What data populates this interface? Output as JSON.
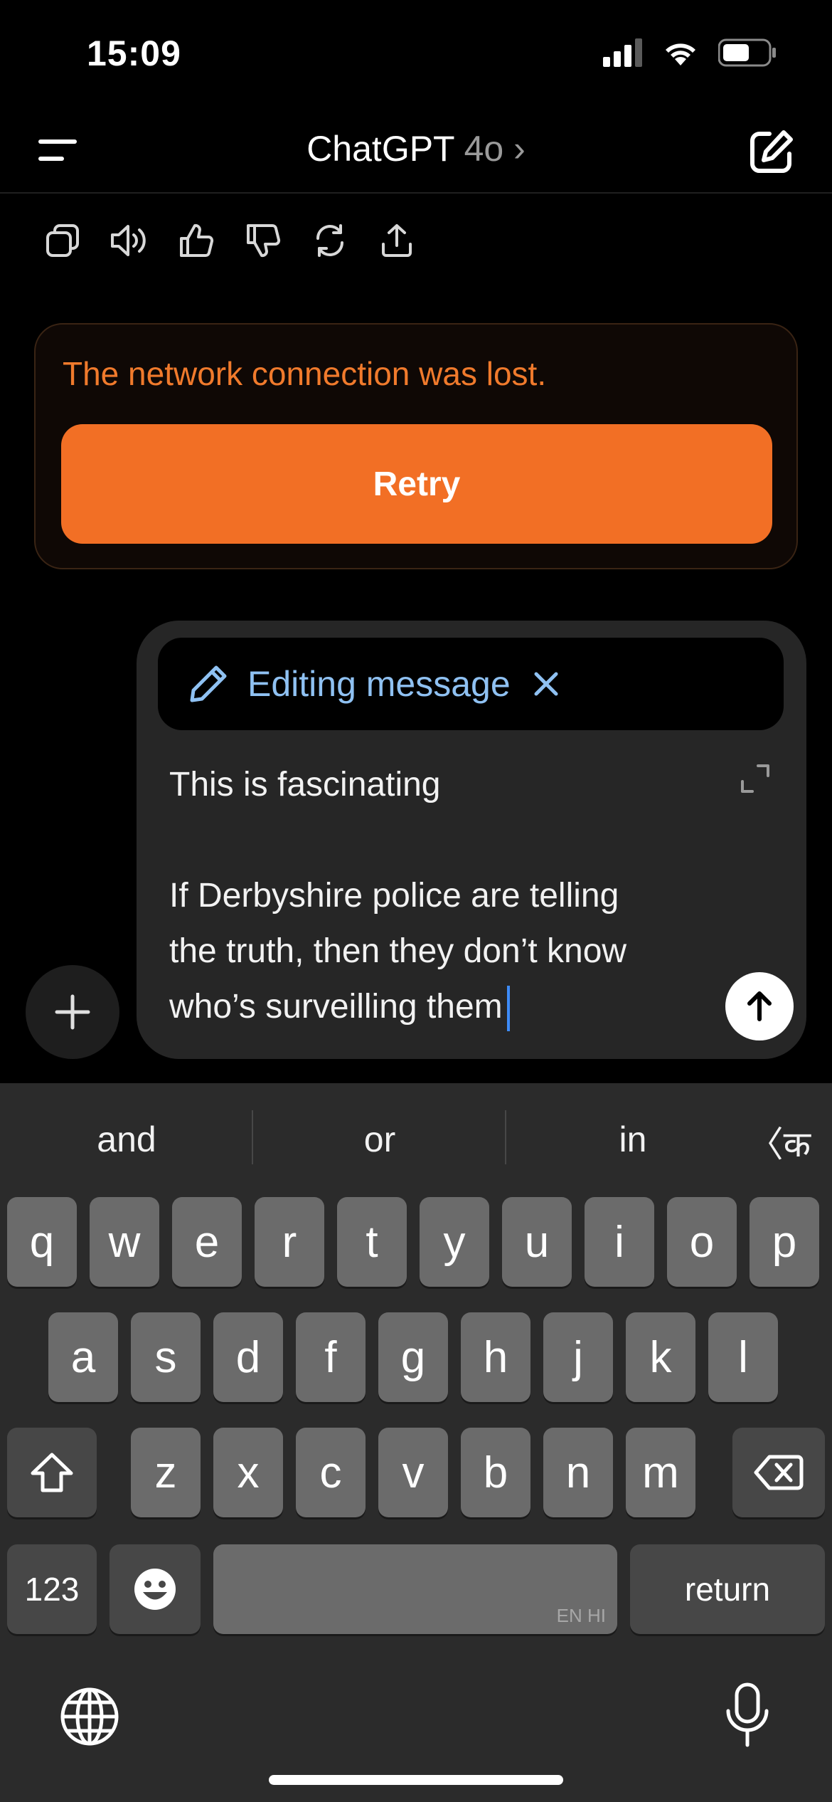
{
  "status": {
    "time": "15:09",
    "icons": [
      "signal-icon",
      "wifi-icon",
      "battery-icon"
    ]
  },
  "nav": {
    "title": "ChatGPT",
    "model": "4o",
    "chevron": "›",
    "icons": [
      "menu-icon",
      "new-chat-icon"
    ]
  },
  "actions": [
    "copy-icon",
    "read-aloud-icon",
    "thumbs-up-icon",
    "thumbs-down-icon",
    "regenerate-icon",
    "share-icon"
  ],
  "error": {
    "message": "The network connection was lost.",
    "retry_label": "Retry",
    "accent": "#f26f25"
  },
  "composer": {
    "editing_label": "Editing message",
    "close_glyph": "✕",
    "lines": [
      "This is fascinating",
      "",
      "If Derbyshire police are telling",
      "the truth, then they don’t know",
      "who’s surveilling them"
    ],
    "link_color": "#8fc1f2"
  },
  "keyboard": {
    "suggestions": [
      "and",
      "or",
      "in"
    ],
    "lang_switch": "〈क",
    "row1": [
      "q",
      "w",
      "e",
      "r",
      "t",
      "y",
      "u",
      "i",
      "o",
      "p"
    ],
    "row2": [
      "a",
      "s",
      "d",
      "f",
      "g",
      "h",
      "j",
      "k",
      "l"
    ],
    "row3": [
      "z",
      "x",
      "c",
      "v",
      "b",
      "n",
      "m"
    ],
    "numbers_label": "123",
    "return_label": "return",
    "space_lang": "EN HI",
    "icons": [
      "shift-icon",
      "backspace-icon",
      "emoji-icon",
      "globe-icon",
      "microphone-icon"
    ]
  }
}
